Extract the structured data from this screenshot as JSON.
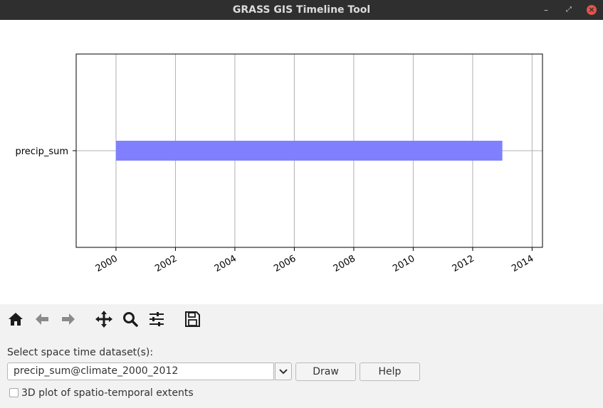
{
  "window": {
    "title": "GRASS GIS Timeline Tool",
    "controls": [
      "minimize-icon",
      "maximize-icon",
      "close-icon"
    ]
  },
  "toolbar": {
    "icons": [
      "home-icon",
      "back-arrow-icon",
      "forward-arrow-icon",
      "pan-move-icon",
      "zoom-magnifier-icon",
      "configure-subplots-icon",
      "save-floppy-icon"
    ]
  },
  "chart_data": {
    "type": "bar",
    "orientation": "horizontal",
    "categories": [
      "precip_sum"
    ],
    "series": [
      {
        "start": 2000,
        "end": 2013,
        "color": "#8080ff"
      }
    ],
    "x_ticks": [
      "2000",
      "2002",
      "2004",
      "2006",
      "2008",
      "2010",
      "2012",
      "2014"
    ],
    "xlim": [
      1998.66,
      2014.35
    ],
    "grid": true
  },
  "form": {
    "dataset_label": "Select space time dataset(s):",
    "dataset_value": "precip_sum@climate_2000_2012",
    "draw_button": "Draw",
    "help_button": "Help",
    "checkbox_label": "3D plot of spatio-temporal extents",
    "checkbox_checked": false
  }
}
